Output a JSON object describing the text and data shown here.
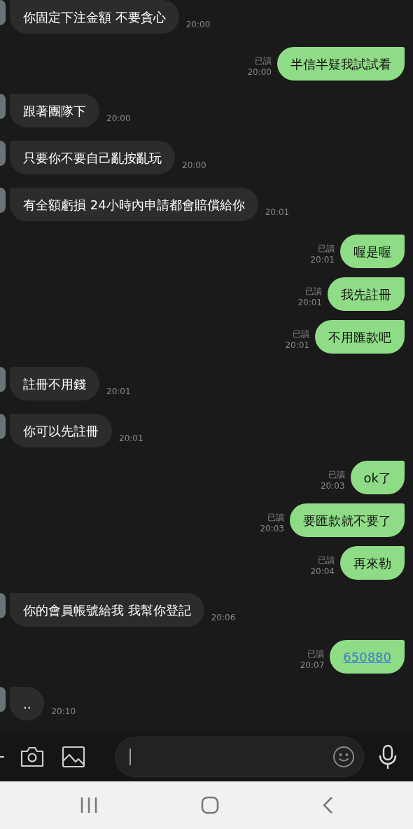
{
  "messages": [
    {
      "kind": "incoming",
      "text": "你固定下注金額 不要貪心",
      "time": "20:00"
    },
    {
      "kind": "outgoing",
      "text": "半信半疑我試試看",
      "read": "已讀",
      "time": "20:00",
      "link": false
    },
    {
      "kind": "incoming",
      "text": "跟著團隊下",
      "time": "20:00"
    },
    {
      "kind": "incoming",
      "text": "只要你不要自己亂按亂玩",
      "time": "20:00"
    },
    {
      "kind": "incoming",
      "text": "有全額虧損 24小時內申請都會賠償給你",
      "time": "20:01"
    },
    {
      "kind": "outgoing",
      "text": "喔是喔",
      "read": "已讀",
      "time": "20:01",
      "link": false
    },
    {
      "kind": "outgoing",
      "text": "我先註冊",
      "read": "已讀",
      "time": "20:01",
      "link": false
    },
    {
      "kind": "outgoing",
      "text": "不用匯款吧",
      "read": "已讀",
      "time": "20:01",
      "link": false
    },
    {
      "kind": "incoming",
      "text": "註冊不用錢",
      "time": "20:01"
    },
    {
      "kind": "incoming",
      "text": "你可以先註冊",
      "time": "20:01"
    },
    {
      "kind": "outgoing",
      "text": "ok了",
      "read": "已讀",
      "time": "20:03",
      "link": false
    },
    {
      "kind": "outgoing",
      "text": "要匯款就不要了",
      "read": "已讀",
      "time": "20:03",
      "link": false
    },
    {
      "kind": "outgoing",
      "text": "再來勒",
      "read": "已讀",
      "time": "20:04",
      "link": false
    },
    {
      "kind": "incoming",
      "text": "你的會員帳號給我 我幫你登記",
      "time": "20:06"
    },
    {
      "kind": "outgoing",
      "text": "650880",
      "read": "已讀",
      "time": "20:07",
      "link": true
    },
    {
      "kind": "incoming",
      "text": "..",
      "time": "20:10"
    }
  ]
}
